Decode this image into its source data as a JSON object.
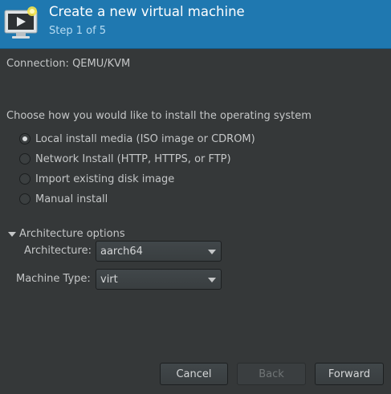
{
  "header": {
    "title": "Create a new virtual machine",
    "step": "Step 1 of 5",
    "icon": "monitor-play-icon"
  },
  "connection": {
    "label": "Connection:",
    "value": "QEMU/KVM"
  },
  "install": {
    "prompt": "Choose how you would like to install the operating system",
    "options": [
      {
        "label": "Local install media (ISO image or CDROM)",
        "checked": true
      },
      {
        "label": "Network Install (HTTP, HTTPS, or FTP)",
        "checked": false
      },
      {
        "label": "Import existing disk image",
        "checked": false
      },
      {
        "label": "Manual install",
        "checked": false
      }
    ]
  },
  "architecture": {
    "expander_label": "Architecture options",
    "arch_label": "Architecture:",
    "arch_value": "aarch64",
    "machine_label": "Machine Type:",
    "machine_value": "virt"
  },
  "buttons": {
    "cancel": "Cancel",
    "back": "Back",
    "forward": "Forward"
  },
  "colors": {
    "header_bg": "#1f78b0",
    "window_bg": "#353839"
  }
}
